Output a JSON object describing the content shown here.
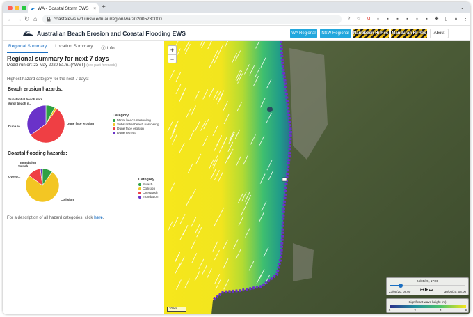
{
  "browser": {
    "tab_title": "WA - Coastal Storm EWS",
    "url": "coastalews.wrl.unsw.edu.au/region/wa/202005230000",
    "new_tab": "+",
    "tab_menu": "⌄",
    "nav": {
      "back": "←",
      "forward": "→",
      "reload": "↻",
      "home": "⌂"
    },
    "ext_icons": [
      "share-icon",
      "star-icon",
      "gmail-icon",
      "extension-icon",
      "extension-icon",
      "extension-icon",
      "extension-icon",
      "extension-icon",
      "extension-icon",
      "puzzle-icon",
      "sidebar-icon",
      "profile-icon",
      "menu-icon"
    ]
  },
  "header": {
    "title": "Australian Beach Erosion and Coastal Flooding EWS",
    "buttons": {
      "wa": "WA Regional",
      "nsw": "NSW Regional",
      "narrabeen": "Narrabeen Hi-Res",
      "mandurah": "Mandurah Hi-Res",
      "about": "About"
    }
  },
  "left": {
    "tabs": {
      "regional": "Regional Summary",
      "location": "Location Summary",
      "info": "Info"
    },
    "heading": "Regional summary for next 7 days",
    "model_run_label": "Model run on:",
    "model_run_value": "23 May 2020 8a.m. (AWST)",
    "model_run_link": "(see past forecasts)",
    "highest": "Highest hazard category for the next 7 days:",
    "erosion_title": "Beach erosion hazards:",
    "flooding_title": "Coastal flooding hazards:",
    "footnote_pre": "For a description of all hazard categories, click",
    "footnote_link": "here",
    "footnote_post": "."
  },
  "chart_data": [
    {
      "type": "pie",
      "title": "Beach erosion hazards:",
      "labels": [
        "Minor beach narrowing",
        "Substantial beach narrowing",
        "Dune face erosion",
        "Dune retreat"
      ],
      "slice_labels": [
        "Minor beach n...",
        "Substantial beach narr...",
        "Dune face erosion",
        "Dune re..."
      ],
      "values": [
        8,
        2,
        55,
        35
      ],
      "colors": [
        "#2ea043",
        "#f3c623",
        "#ef3f44",
        "#6a32c9"
      ],
      "legend_title": "Category",
      "legend_position": "right"
    },
    {
      "type": "pie",
      "title": "Coastal flooding hazards:",
      "labels": [
        "Swash",
        "Collision",
        "Overwash",
        "Inundation"
      ],
      "slice_labels": [
        "Swash",
        "Collision",
        "Overw...",
        "Inundation"
      ],
      "values": [
        10,
        75,
        13,
        2
      ],
      "colors": [
        "#2ea043",
        "#f3c623",
        "#ef3f44",
        "#6a32c9"
      ],
      "legend_title": "Category",
      "legend_position": "right"
    }
  ],
  "map": {
    "zoom_in": "+",
    "zoom_out": "−",
    "scale_label": "20 km",
    "time_current": "24/05/20, 17:00",
    "time_start": "23/05/20, 08:00",
    "time_end": "30/05/20, 08:00",
    "time_progress": 0.15,
    "wave_title": "Significant wave height (m)",
    "wave_ticks": [
      "0",
      "2",
      "4",
      "6"
    ]
  }
}
